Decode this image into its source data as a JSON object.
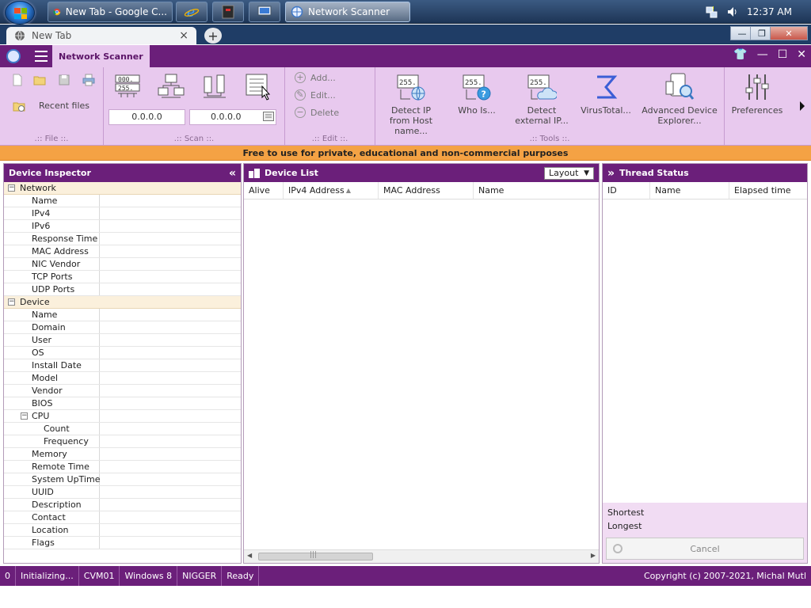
{
  "taskbar": {
    "buttons": [
      {
        "label": "New Tab - Google C...",
        "icon": "chrome-icon"
      },
      {
        "label": "",
        "icon": "internet-explorer-icon"
      },
      {
        "label": "",
        "icon": "app-icon"
      },
      {
        "label": "",
        "icon": "computer-icon"
      },
      {
        "label": "Network Scanner",
        "icon": "network-scanner-icon"
      }
    ],
    "clock": "12:37 AM"
  },
  "browser": {
    "tab_title": "New Tab",
    "new_tab_symbol": "+",
    "close_symbol": "×",
    "win_minimize": "—",
    "win_restore": "❐",
    "win_close": "✕"
  },
  "app": {
    "title": "Network Scanner",
    "colors": {
      "accent": "#6b1f7a",
      "ribbon": "#e8c9ee",
      "banner": "#f4a244"
    }
  },
  "ribbon": {
    "file": {
      "recent_files": "Recent files",
      "group_label": ".:: File ::."
    },
    "scan": {
      "ip_from": "0.0.0.0",
      "ip_to": "0.0.0.0",
      "group_label": ".:: Scan ::."
    },
    "edit": {
      "add": "Add...",
      "edit": "Edit...",
      "delete": "Delete",
      "group_label": ".:: Edit ::."
    },
    "tools": {
      "detect_ip": "Detect IP from Host name...",
      "who_is": "Who Is...",
      "detect_external": "Detect external IP...",
      "virustotal": "VirusTotal...",
      "advanced_explorer": "Advanced Device Explorer...",
      "group_label": ".:: Tools ::."
    },
    "preferences": "Preferences"
  },
  "banner": "Free to use for private, educational and non-commercial  purposes",
  "inspector": {
    "title": "Device Inspector",
    "collapse_symbol": "«",
    "network": {
      "label": "Network",
      "fields": [
        "Name",
        "IPv4",
        "IPv6",
        "Response Time",
        "MAC Address",
        "NIC Vendor",
        "TCP Ports",
        "UDP Ports"
      ]
    },
    "device": {
      "label": "Device",
      "fields_a": [
        "Name",
        "Domain",
        "User",
        "OS",
        "Install Date",
        "Model",
        "Vendor",
        "BIOS"
      ],
      "cpu": {
        "label": "CPU",
        "fields": [
          "Count",
          "Frequency"
        ]
      },
      "fields_b": [
        "Memory",
        "Remote Time",
        "System UpTime",
        "UUID",
        "Description",
        "Contact",
        "Location",
        "Flags"
      ]
    }
  },
  "device_list": {
    "title": "Device List",
    "layout_label": "Layout",
    "columns": [
      "Alive",
      "IPv4 Address",
      "MAC Address",
      "Name"
    ],
    "sort_column": "IPv4 Address",
    "scroll_grip": "|||"
  },
  "thread_status": {
    "title": "Thread Status",
    "expand_symbol": "»",
    "columns": [
      "ID",
      "Name",
      "Elapsed time"
    ],
    "shortest": "Shortest",
    "longest": "Longest",
    "cancel": "Cancel"
  },
  "status_bar": {
    "segments": [
      "0",
      "Initializing...",
      "CVM01",
      "Windows 8",
      "NIGGER",
      "Ready"
    ],
    "copyright": "Copyright (c) 2007-2021, Michal Mutl"
  }
}
